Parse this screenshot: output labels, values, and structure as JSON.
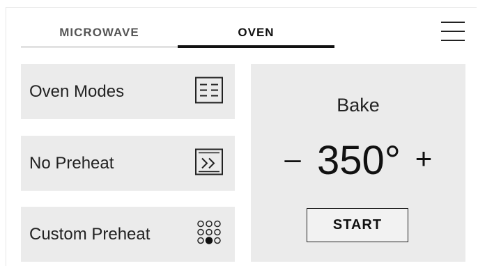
{
  "tabs": {
    "microwave": "MICROWAVE",
    "oven": "OVEN",
    "active": "oven"
  },
  "menu": {
    "icon": "hamburger-icon"
  },
  "modes": [
    {
      "label": "Oven Modes",
      "icon": "list-icon"
    },
    {
      "label": "No Preheat",
      "icon": "skip-preheat-icon"
    },
    {
      "label": "Custom Preheat",
      "icon": "dot-grid-icon"
    }
  ],
  "panel": {
    "mode": "Bake",
    "minus": "–",
    "temperature": "350°",
    "plus": "+",
    "start": "START"
  },
  "colors": {
    "card_bg": "#ebebeb",
    "text": "#1a1a1a",
    "active_tab_underline": "#111111"
  }
}
